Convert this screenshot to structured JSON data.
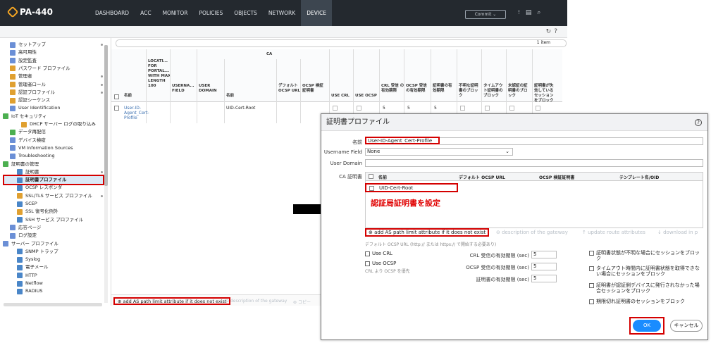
{
  "app": {
    "logo": "PA-440"
  },
  "nav": {
    "tabs": [
      "DASHBOARD",
      "ACC",
      "MONITOR",
      "POLICIES",
      "OBJECTS",
      "NETWORK",
      "DEVICE"
    ],
    "active": "DEVICE",
    "commit": "Commit"
  },
  "sidebar": {
    "items": [
      {
        "label": "セットアップ",
        "color": "#6b8fd6"
      },
      {
        "label": "高可用性",
        "color": "#6b8fd6"
      },
      {
        "label": "設定監査",
        "color": "#6b8fd6"
      },
      {
        "label": "パスワード プロファイル",
        "color": "#e0a030"
      },
      {
        "label": "管理者",
        "color": "#e0a030"
      },
      {
        "label": "管理者ロール",
        "color": "#e0a030"
      },
      {
        "label": "認証プロファイル",
        "color": "#e0a030"
      },
      {
        "label": "認証シーケンス",
        "color": "#e0a030"
      },
      {
        "label": "User Identification",
        "color": "#6b8fd6"
      },
      {
        "label": "IoT セキュリティ",
        "color": "#4caf50"
      },
      {
        "label": "DHCP サーバー ログの取り込み",
        "color": "#e0a030"
      },
      {
        "label": "データ再配信",
        "color": "#4caf50"
      },
      {
        "label": "デバイス検疫",
        "color": "#6b8fd6"
      },
      {
        "label": "VM Information Sources",
        "color": "#6b8fd6"
      },
      {
        "label": "Troubleshooting",
        "color": "#6b8fd6"
      },
      {
        "label": "証明書の管理",
        "color": "#4caf50"
      },
      {
        "label": "証明書",
        "color": "#4a86c8"
      },
      {
        "label": "証明書プロファイル",
        "color": "#4a86c8"
      },
      {
        "label": "OCSP レスポンダ",
        "color": "#4a86c8"
      },
      {
        "label": "SSL/TLS サービス プロファイル",
        "color": "#e0a030"
      },
      {
        "label": "SCEP",
        "color": "#4a86c8"
      },
      {
        "label": "SSL 復号化例外",
        "color": "#e0a030"
      },
      {
        "label": "SSH サービス プロファイル",
        "color": "#4a86c8"
      },
      {
        "label": "応答ページ",
        "color": "#6b8fd6"
      },
      {
        "label": "ログ設定",
        "color": "#6b8fd6"
      },
      {
        "label": "サーバー プロファイル",
        "color": "#6b8fd6"
      },
      {
        "label": "SNMP トラップ",
        "color": "#4a86c8"
      },
      {
        "label": "Syslog",
        "color": "#4a86c8"
      },
      {
        "label": "電子メール",
        "color": "#4a86c8"
      },
      {
        "label": "HTTP",
        "color": "#4a86c8"
      },
      {
        "label": "Netflow",
        "color": "#4a86c8"
      },
      {
        "label": "RADIUS",
        "color": "#4a86c8"
      }
    ]
  },
  "main": {
    "items_count": "1 item",
    "table": {
      "ca_header": "CA",
      "columns": [
        "名前",
        "LOCATI... FOR PORTAL... WITH MAX LENGTH 100",
        "USERNA... FIELD",
        "USER DOMAIN",
        "名前",
        "デフォルト OCSP URL",
        "OCSP 検証 証明書",
        "USE CRL",
        "USE OCSP",
        "CRL 受信 の有効期限",
        "OCSP 受信 の有効期限",
        "証明書の有 効期限",
        "不明な証明 書のブロッ ク",
        "タイムアウ ト証明書の ブロック",
        "未認証の証 明書のブロ ック",
        "証明書が失 効している セッション をブロック"
      ],
      "row": {
        "name": "User-ID-Agent_Cert-Profile",
        "ca_name": "UID-Cert-Root",
        "crl": "5",
        "ocsp": "5",
        "cert": "5"
      }
    },
    "bottom": {
      "add": "add AS path limit attribute if it does not exist",
      "desc": "description of the gateway",
      "copy": "コピー"
    }
  },
  "dialog": {
    "title": "証明書プロファイル",
    "name_label": "名前",
    "name_value": "User-ID-Agent_Cert-Profile",
    "username_label": "Username Field",
    "username_value": "None",
    "domain_label": "User Domain",
    "ca_label": "CA 証明書",
    "ca_columns": [
      "名前",
      "デフォルト OCSP URL",
      "OCSP 検証証明書",
      "テンプレート名/OID"
    ],
    "ca_row": "UID-Cert-Root",
    "annotation": "認証局証明書を設定",
    "toolbar": {
      "add": "add AS path limit attribute if it does not exist",
      "desc": "description of the gateway",
      "update": "update route attributes",
      "download": "download in p"
    },
    "ocsp_url_hint": "デフォルト OCSP URL (http:// または https:// で開始する必要あり)",
    "use_crl": "Use CRL",
    "use_ocsp": "Use OCSP",
    "ocsp_note": "CRL より OCSP を優先",
    "crl_timeout_label": "CRL 受信の有効期限 (sec)",
    "crl_timeout": "5",
    "ocsp_timeout_label": "OCSP 受信の有効期限 (sec)",
    "ocsp_timeout": "5",
    "cert_timeout_label": "証明書の有効期限 (sec)",
    "cert_timeout": "5",
    "checks": [
      "証明書状態が不明な場合にセッションをブロック",
      "タイムアウト時間内に証明書状態を取得できない場合にセッションをブロック",
      "証明書が認証側デバイスに発行されなかった場合セッションをブロック",
      "期限切れ証明書のセッションをブロック"
    ],
    "ok": "OK",
    "cancel": "キャンセル"
  }
}
